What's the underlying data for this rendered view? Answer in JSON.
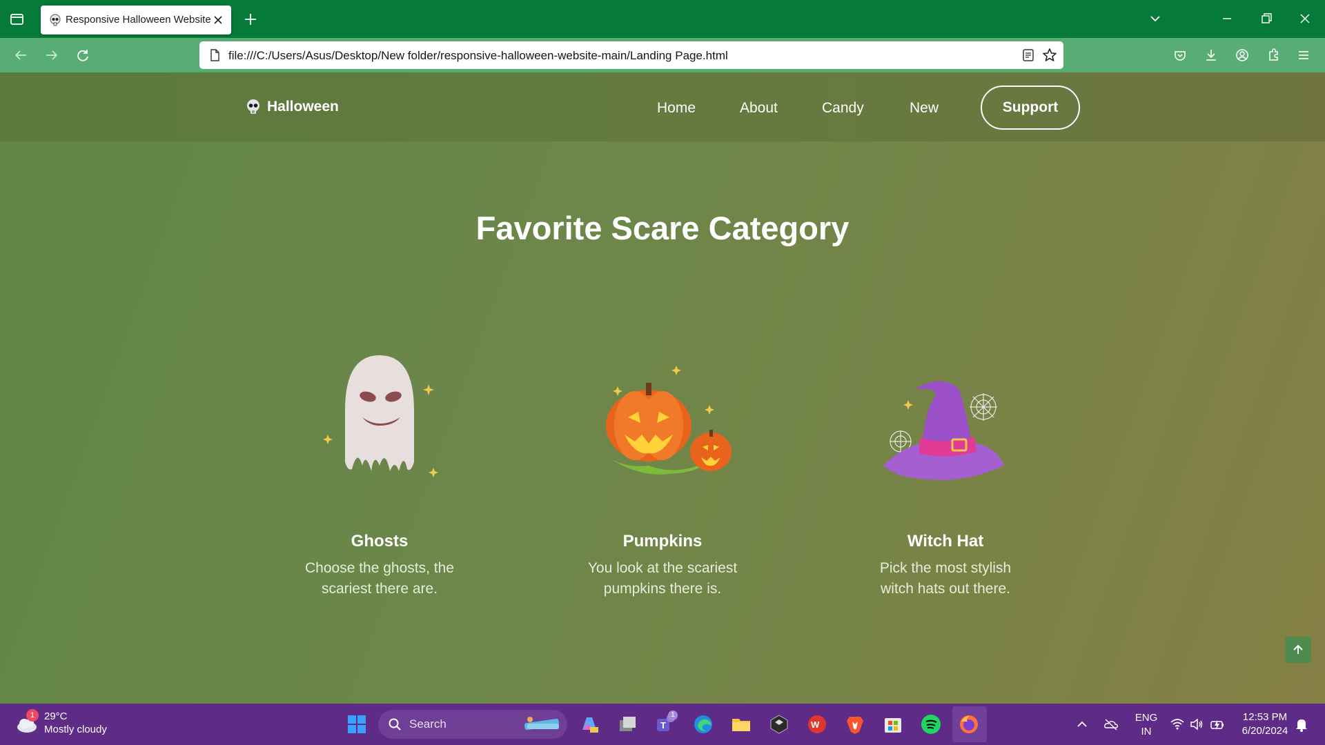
{
  "browser": {
    "tab_title": "Responsive Halloween Website",
    "url": "file:///C:/Users/Asus/Desktop/New folder/responsive-halloween-website-main/Landing Page.html"
  },
  "site": {
    "logo_text": "Halloween",
    "nav": {
      "home": "Home",
      "about": "About",
      "candy": "Candy",
      "new": "New",
      "support": "Support"
    },
    "section_title": "Favorite Scare Category",
    "cards": [
      {
        "title": "Ghosts",
        "description": "Choose the ghosts, the scariest there are.",
        "icon": "ghost-icon"
      },
      {
        "title": "Pumpkins",
        "description": "You look at the scariest pumpkins there is.",
        "icon": "pumpkin-icon"
      },
      {
        "title": "Witch Hat",
        "description": "Pick the most stylish witch hats out there.",
        "icon": "witch-hat-icon"
      }
    ]
  },
  "taskbar": {
    "weather_badge": "1",
    "temperature": "29°C",
    "condition": "Mostly cloudy",
    "search_placeholder": "Search",
    "teams_badge": "1",
    "language": "ENG",
    "region": "IN",
    "time": "12:53 PM",
    "date": "6/20/2024"
  },
  "colors": {
    "tabbar": "#067a38",
    "toolbar": "#57ad73",
    "page_green": "#5f8648",
    "page_olive": "#857f44",
    "taskbar": "#5e2b87"
  }
}
